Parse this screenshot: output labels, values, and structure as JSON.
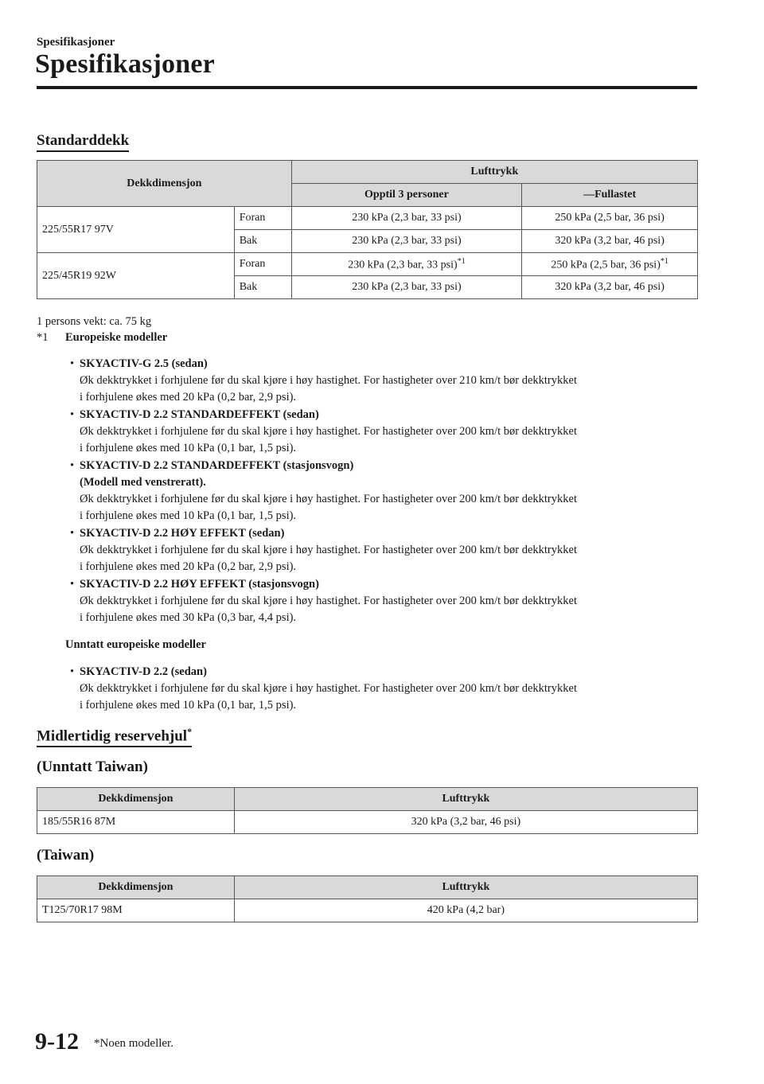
{
  "header": {
    "small": "Spesifikasjoner",
    "title": "Spesifikasjoner"
  },
  "standard": {
    "heading": "Standarddekk",
    "table": {
      "col_dim": "Dekkdimensjon",
      "col_pressure": "Lufttrykk",
      "sub_col1": "Opptil 3 personer",
      "sub_col2": "—Fullastet",
      "rows": [
        {
          "dim": "225/55R17 97V",
          "pos": [
            {
              "label": "Foran",
              "v1": "230 kPa (2,3 bar, 33 psi)",
              "v2": "250 kPa (2,5 bar, 36 psi)"
            },
            {
              "label": "Bak",
              "v1": "230 kPa (2,3 bar, 33 psi)",
              "v2": "320 kPa (3,2 bar, 46 psi)"
            }
          ]
        },
        {
          "dim": "225/45R19 92W",
          "pos": [
            {
              "label": "Foran",
              "v1": "230 kPa (2,3 bar, 33 psi)",
              "v1sup": "*1",
              "v2": "250 kPa (2,5 bar, 36 psi)",
              "v2sup": "*1"
            },
            {
              "label": "Bak",
              "v1": "230 kPa (2,3 bar, 33 psi)",
              "v2": "320 kPa (3,2 bar, 46 psi)"
            }
          ]
        }
      ]
    },
    "weight_note": "1 persons vekt: ca. 75 kg",
    "fn_mark": "*1",
    "fn_title": "Europeiske modeller",
    "bullets": [
      {
        "title": "SKYACTIV-G 2.5 (sedan)",
        "lines": [
          "Øk dekktrykket i forhjulene før du skal kjøre i høy hastighet. For hastigheter over 210 km/t bør dekktrykket",
          "i forhjulene økes med 20 kPa (0,2 bar, 2,9 psi)."
        ]
      },
      {
        "title": "SKYACTIV-D 2.2 STANDARDEFFEKT (sedan)",
        "lines": [
          "Øk dekktrykket i forhjulene før du skal kjøre i høy hastighet. For hastigheter over 200 km/t bør dekktrykket",
          "i forhjulene økes med 10 kPa (0,1 bar, 1,5 psi)."
        ]
      },
      {
        "title": "SKYACTIV-D 2.2 STANDARDEFFEKT (stasjonsvogn)",
        "title2": "(Modell med venstreratt).",
        "lines": [
          "Øk dekktrykket i forhjulene før du skal kjøre i høy hastighet. For hastigheter over 200 km/t bør dekktrykket",
          "i forhjulene økes med 10 kPa (0,1 bar, 1,5 psi)."
        ]
      },
      {
        "title": "SKYACTIV-D 2.2 HØY EFFEKT (sedan)",
        "lines": [
          "Øk dekktrykket i forhjulene før du skal kjøre i høy hastighet. For hastigheter over 200 km/t bør dekktrykket",
          "i forhjulene økes med 20 kPa (0,2 bar, 2,9 psi)."
        ]
      },
      {
        "title": "SKYACTIV-D 2.2 HØY EFFEKT (stasjonsvogn)",
        "lines": [
          "Øk dekktrykket i forhjulene før du skal kjøre i høy hastighet. For hastigheter over 200 km/t bør dekktrykket",
          "i forhjulene økes med 30 kPa (0,3 bar, 4,4 psi)."
        ]
      }
    ],
    "non_eu_title": "Unntatt europeiske modeller",
    "non_eu_bullet": {
      "title": "SKYACTIV-D 2.2 (sedan)",
      "lines": [
        "Øk dekktrykket i forhjulene før du skal kjøre i høy hastighet. For hastigheter over 200 km/t bør dekktrykket",
        "i forhjulene økes med 10 kPa (0,1 bar, 1,5 psi)."
      ]
    }
  },
  "spare": {
    "heading": "Midlertidig reservehjul",
    "heading_sup": "*",
    "non_taiwan": {
      "title": "(Unntatt Taiwan)",
      "col_dim": "Dekkdimensjon",
      "col_pressure": "Lufttrykk",
      "dim": "185/55R16 87M",
      "pressure": "320 kPa (3,2 bar, 46 psi)"
    },
    "taiwan": {
      "title": "(Taiwan)",
      "col_dim": "Dekkdimensjon",
      "col_pressure": "Lufttrykk",
      "dim": "T125/70R17 98M",
      "pressure": "420 kPa (4,2 bar)"
    }
  },
  "footer": {
    "page": "9-12",
    "note": "*Noen modeller."
  }
}
